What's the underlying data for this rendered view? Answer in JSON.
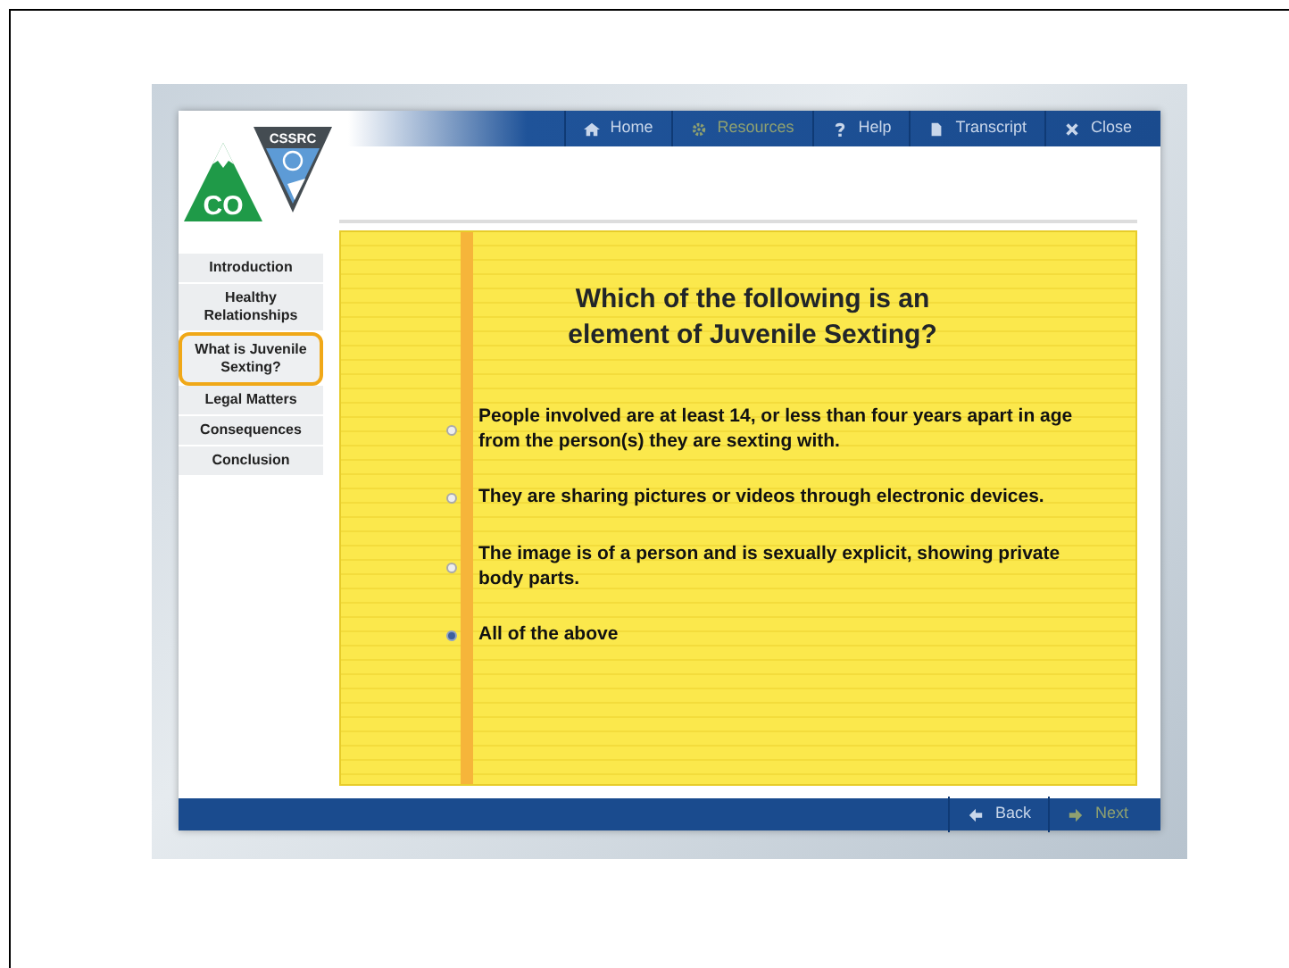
{
  "logo": {
    "text": "CO",
    "badge": "CSSRC"
  },
  "toolbar": [
    {
      "label": "Home",
      "kind": "home",
      "disabled": false
    },
    {
      "label": "Resources",
      "kind": "gear",
      "disabled": true
    },
    {
      "label": "Help",
      "kind": "help",
      "disabled": false
    },
    {
      "label": "Transcript",
      "kind": "page",
      "disabled": false
    },
    {
      "label": "Close",
      "kind": "close",
      "disabled": false
    }
  ],
  "sidebar": {
    "items": [
      {
        "label": "Introduction",
        "selected": false
      },
      {
        "label": "Healthy Relationships",
        "selected": false
      },
      {
        "label": "What is Juvenile Sexting?",
        "selected": true
      },
      {
        "label": "Legal Matters",
        "selected": false
      },
      {
        "label": "Consequences",
        "selected": false
      },
      {
        "label": "Conclusion",
        "selected": false
      }
    ]
  },
  "question": {
    "title": "Which of the following is an element of Juvenile Sexting?",
    "options": [
      {
        "text": "People involved are at least 14, or less than four years apart in age from the person(s) they are sexting with.",
        "selected": false
      },
      {
        "text": "They are sharing pictures or videos through electronic devices.",
        "selected": false
      },
      {
        "text": "The image is of a person and is sexually explicit, showing private body parts.",
        "selected": false
      },
      {
        "text": "All of the above",
        "selected": true
      }
    ]
  },
  "footer": [
    {
      "label": "Back",
      "kind": "back",
      "disabled": false
    },
    {
      "label": "Next",
      "kind": "next",
      "disabled": true
    }
  ]
}
